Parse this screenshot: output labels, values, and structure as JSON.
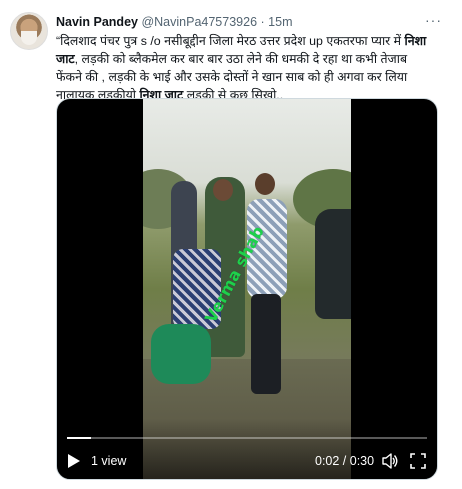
{
  "tweet": {
    "author_name": "Navin Pandey",
    "author_handle": "@NavinPa47573926",
    "separator": "·",
    "time_ago": "15m",
    "more_label": "···",
    "text_line1_a": "“दिलशाद पंचर पुत्र s /o नसीबूद्दीन जिला मेरठ उत्तर प्रदेश up एकतरफा प्यार में ",
    "text_bold1": "निशा जाट",
    "text_line1_b": ", लड़की को ब्लैकमेल कर बार बार उठा लेने की धमकी दे रहा था कभी तेजाब फेंकने की , लड़की के भाई और उसके दोस्तों ने खान साब को ही अगवा कर लिया नालायक लड़कीयो ",
    "text_bold2": "निशा जाट",
    "text_line1_c": " लड़की से कुछ सिखो,,"
  },
  "video": {
    "watermark": "Verma shab",
    "views": "1 view",
    "timecode": "0:02 / 0:30",
    "progress_fraction": 0.067
  },
  "colors": {
    "name": "#0f1419",
    "secondary": "#536471",
    "watermark": "#1dd14b"
  },
  "icons": {
    "play": "play-icon",
    "volume": "volume-icon",
    "fullscreen": "fullscreen-icon",
    "more": "more-icon"
  }
}
